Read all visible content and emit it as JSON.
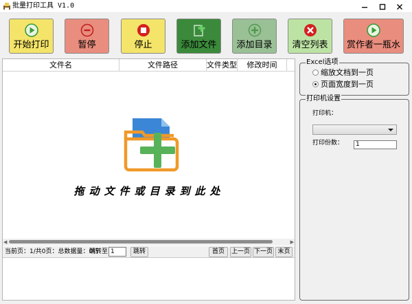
{
  "window": {
    "title": "批量打印工具 V1.0"
  },
  "toolbar": [
    {
      "label": "开始打印",
      "bg": "#f4e469",
      "icon": "play-icon"
    },
    {
      "label": "暂停",
      "bg": "#e98d7e",
      "icon": "minus-circle-icon"
    },
    {
      "label": "停止",
      "bg": "#f4e469",
      "icon": "stop-icon"
    },
    {
      "label": "添加文件",
      "bg": "#3b8a3b",
      "icon": "add-file-icon"
    },
    {
      "label": "添加目录",
      "bg": "#9ac096",
      "icon": "add-folder-icon"
    },
    {
      "label": "清空列表",
      "bg": "#bde3a4",
      "icon": "clear-icon"
    },
    {
      "label": "赏作者一瓶水",
      "bg": "#e98d7e",
      "icon": "donate-icon"
    }
  ],
  "file_list": {
    "columns": [
      "文件名",
      "文件路径",
      "文件类型",
      "修改时间"
    ],
    "drop_hint": "拖动文件或目录到此处"
  },
  "pager": {
    "info": "当前页：1/共0页：总数据量：0行",
    "jump_label": "跳转至",
    "jump_value": "1",
    "jump_button": "跳转",
    "first": "首页",
    "prev": "上一页",
    "next": "下一页",
    "last": "末页"
  },
  "excel_options": {
    "legend": "Excel选项",
    "options": [
      {
        "label": "缩放文档到一页",
        "selected": false
      },
      {
        "label": "页面宽度到一页",
        "selected": true
      }
    ]
  },
  "printer_settings": {
    "legend": "打印机设置",
    "printer_label": "打印机：",
    "printer_value": "",
    "copies_label": "打印份数：",
    "copies_value": "1"
  },
  "colors": {
    "accent_orange": "#f0992a",
    "accent_blue": "#3b86d6",
    "accent_green": "#58b25a"
  }
}
